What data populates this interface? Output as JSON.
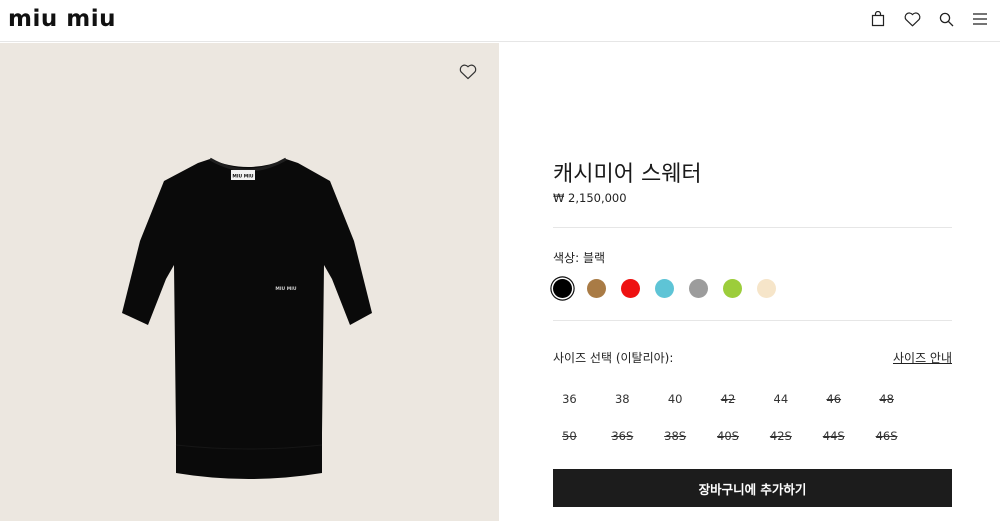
{
  "header": {
    "logo": "miu miu",
    "icons": [
      "bag-icon",
      "heart-icon",
      "search-icon",
      "menu-icon"
    ]
  },
  "product": {
    "name": "캐시미어 스웨터",
    "price": "₩ 2,150,000",
    "color_label": "색상:  블랙",
    "colors": [
      {
        "name": "black",
        "hex": "#000000",
        "selected": true
      },
      {
        "name": "brown",
        "hex": "#a97b45",
        "selected": false
      },
      {
        "name": "red",
        "hex": "#ee1111",
        "selected": false
      },
      {
        "name": "light-blue",
        "hex": "#5ec4d6",
        "selected": false
      },
      {
        "name": "grey",
        "hex": "#9c9c9c",
        "selected": false
      },
      {
        "name": "lime",
        "hex": "#9ccd3b",
        "selected": false
      },
      {
        "name": "cream",
        "hex": "#f6e5c9",
        "selected": false
      }
    ],
    "size_label": "사이즈 선택 (이탈리아):",
    "size_guide": "사이즈 안내",
    "sizes_row1": [
      {
        "label": "36",
        "available": true
      },
      {
        "label": "38",
        "available": true
      },
      {
        "label": "40",
        "available": true
      },
      {
        "label": "42",
        "available": false
      },
      {
        "label": "44",
        "available": true
      },
      {
        "label": "46",
        "available": false
      },
      {
        "label": "48",
        "available": false
      }
    ],
    "sizes_row2": [
      {
        "label": "50",
        "available": false
      },
      {
        "label": "36S",
        "available": false
      },
      {
        "label": "38S",
        "available": false
      },
      {
        "label": "40S",
        "available": false
      },
      {
        "label": "42S",
        "available": false
      },
      {
        "label": "44S",
        "available": false
      },
      {
        "label": "46S",
        "available": false
      }
    ],
    "add_to_cart": "장바구니에 추가하기"
  },
  "image": {
    "label_text": "MIU MIU",
    "embroidery_text": "MIU MIU"
  }
}
